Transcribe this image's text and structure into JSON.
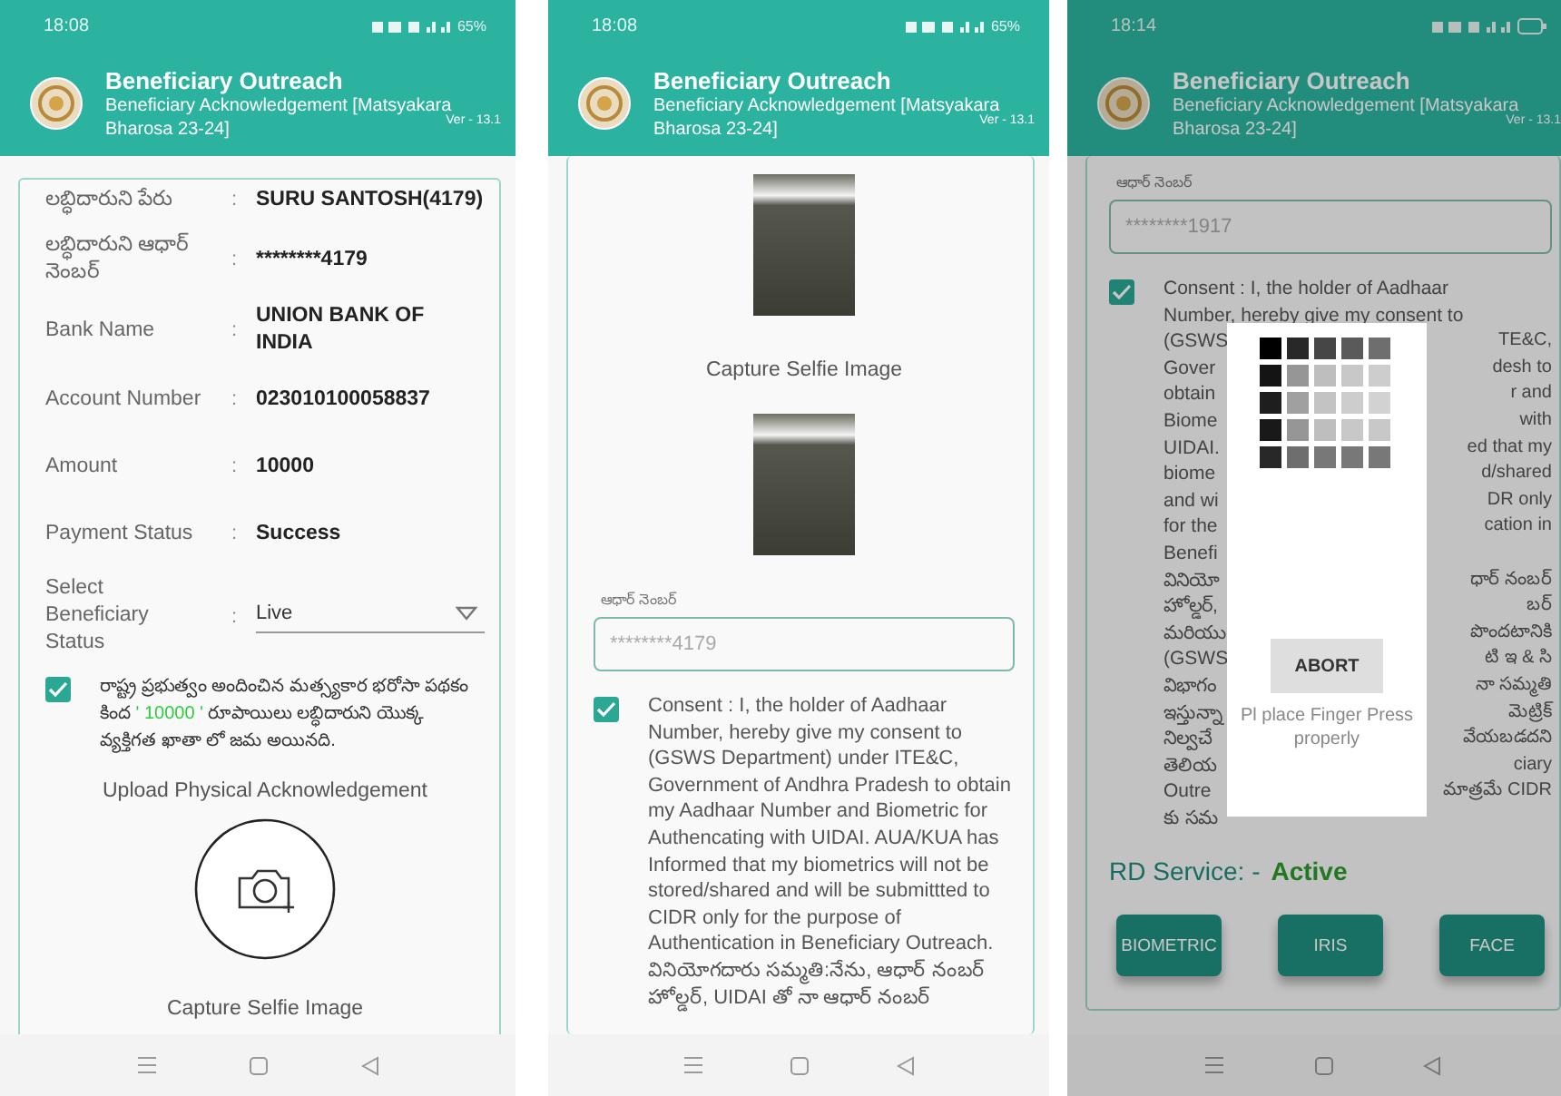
{
  "screens": [
    {
      "kind": "details",
      "dimmed": false,
      "status_bar": {
        "time": "18:08",
        "battery": "65%"
      },
      "header": {
        "title": "Beneficiary Outreach",
        "subtitle_lines": [
          "Beneficiary Acknowledgement [Matsyakara",
          "Bharosa 23-24]"
        ],
        "version": "Ver - 13.1"
      },
      "details": [
        {
          "label": "లబ్ధిదారుని పేరు",
          "separator": ":",
          "value": "SURU SANTOSH(4179)"
        },
        {
          "label": "లబ్ధిదారుని ఆధార్ నెంబర్",
          "separator": ":",
          "value": "********4179"
        },
        {
          "label": "Bank Name",
          "separator": ":",
          "value": "UNION BANK OF INDIA"
        },
        {
          "label": "Account Number",
          "separator": ":",
          "value": "023010100058837"
        },
        {
          "label": "Amount",
          "separator": ":",
          "value": "10000"
        },
        {
          "label": "Payment Status",
          "separator": ":",
          "value": "Success"
        }
      ],
      "status_select": {
        "label": "Select Beneficiary Status",
        "separator": ":",
        "value": "Live"
      },
      "declaration": {
        "checked": true,
        "text_before": "రాష్ట్ర ప్రభుత్వం  అందించిన మత్స్యకార భరోసా పథకం కింద ",
        "amount": "' 10000 '",
        "text_after": " రూపాయిలు  లబ్ధిదారుని యొక్క  వ్యక్తిగత ఖాతా లో జమ అయినది."
      },
      "upload_title": "Upload Physical Acknowledgement",
      "selfie_caption": "Capture Selfie Image"
    },
    {
      "kind": "selfie",
      "dimmed": false,
      "status_bar": {
        "time": "18:08",
        "battery": "65%"
      },
      "header": {
        "title": "Beneficiary Outreach",
        "subtitle_lines": [
          "Beneficiary Acknowledgement [Matsyakara",
          "Bharosa 23-24]"
        ],
        "version": "Ver - 13.1"
      },
      "photo_caption": "Capture Selfie Image",
      "aadhaar_field": {
        "label": "ఆధార్ నెంబర్",
        "value": "********4179"
      },
      "consent": {
        "checked": true,
        "text": "Consent : I, the holder of Aadhaar Number, hereby give my consent to (GSWS Department) under ITE&C, Government of Andhra Pradesh to obtain my Aadhaar Number and Biometric for Authencating with UIDAI. AUA/KUA has Informed that my biometrics will not be stored/shared and will be submittted to CIDR only for the purpose of Authentication in Beneficiary Outreach.",
        "text_telugu": "వినియోగదారు సమ్మతి:నేను, ఆధార్ నంబర్ హోల్డర్, UIDAI తో నా ఆధార్ నంబర్"
      }
    },
    {
      "kind": "biometric",
      "dimmed": true,
      "status_bar": {
        "time": "18:14"
      },
      "header": {
        "title": "Beneficiary Outreach",
        "subtitle_lines": [
          "Beneficiary Acknowledgement [Matsyakara",
          "Bharosa 23-24]"
        ],
        "version": "Ver - 13.1"
      },
      "aadhaar_field": {
        "label": "ఆధార్ నెంబర్",
        "value": "********1917"
      },
      "consent": {
        "checked": true,
        "lines": [
          {
            "left": "Consent : I, the holder of Aadhaar"
          },
          {
            "left": "Number, hereby give my consent to"
          },
          {
            "left": "(GSWS",
            "right": "TE&C,"
          },
          {
            "left": "Gover",
            "right": "desh to"
          },
          {
            "left": "obtain",
            "right": "r and"
          },
          {
            "left": "Biome",
            "right": "with"
          },
          {
            "left": "UIDAI.",
            "right": "ed that my"
          },
          {
            "left": "biome",
            "right": "d/shared"
          },
          {
            "left": "and wi",
            "right": "DR only"
          },
          {
            "left": "for the",
            "right": "cation in"
          },
          {
            "left": "Benefi"
          },
          {
            "left": "వినియో",
            "right": "ధార్ నంబర్"
          },
          {
            "left": "హోల్డర్,",
            "right": "బర్"
          },
          {
            "left": "మరియు",
            "right": "పొందటానికి"
          },
          {
            "left": "(GSWS",
            "right": "టి ఇ & సి"
          },
          {
            "left": "విభాగం",
            "right": "నా సమ్మతి"
          },
          {
            "left": "ఇస్తున్నా",
            "right": "మెట్రిక్"
          },
          {
            "left": "నిల్వచే",
            "right": "వేయబడదని"
          },
          {
            "left": "తెలియ",
            "right": "ciary"
          },
          {
            "left": "Outre",
            "right": "మాత్రమే CIDR"
          },
          {
            "left": "కు సమ"
          }
        ]
      },
      "dialog": {
        "button": "ABORT",
        "message": "Pl place Finger Press properly"
      },
      "rd_service": {
        "label": "RD Service: -",
        "status": "Active"
      },
      "buttons": [
        "BIOMETRIC",
        "IRIS",
        "FACE"
      ]
    }
  ]
}
